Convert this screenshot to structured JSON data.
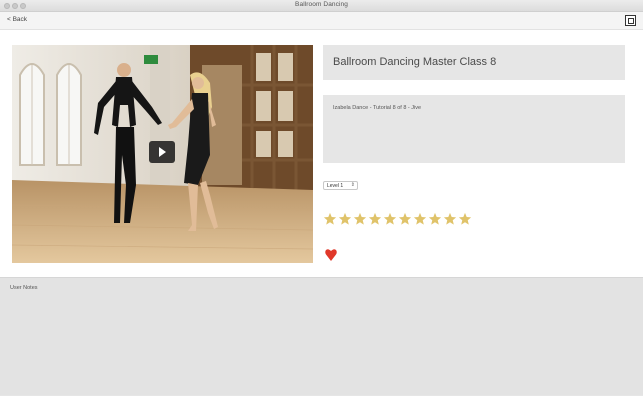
{
  "window": {
    "title": "Ballroom Dancing"
  },
  "toolbar": {
    "back_label": "< Back"
  },
  "video": {
    "thumbnail_icon": "dancers-photo",
    "play_icon": "play-icon"
  },
  "lesson": {
    "title": "Ballroom Dancing Master Class 8",
    "description": "Izabela Dance - Tutorial 8 of 8 - Jive"
  },
  "level": {
    "selected": "Level 1"
  },
  "rating": {
    "stars": 10,
    "filled": 10,
    "star_color": "#e0c36a"
  },
  "favorite": {
    "icon": "heart-icon",
    "color": "#e0382a"
  },
  "notes": {
    "label": "User Notes",
    "value": ""
  }
}
